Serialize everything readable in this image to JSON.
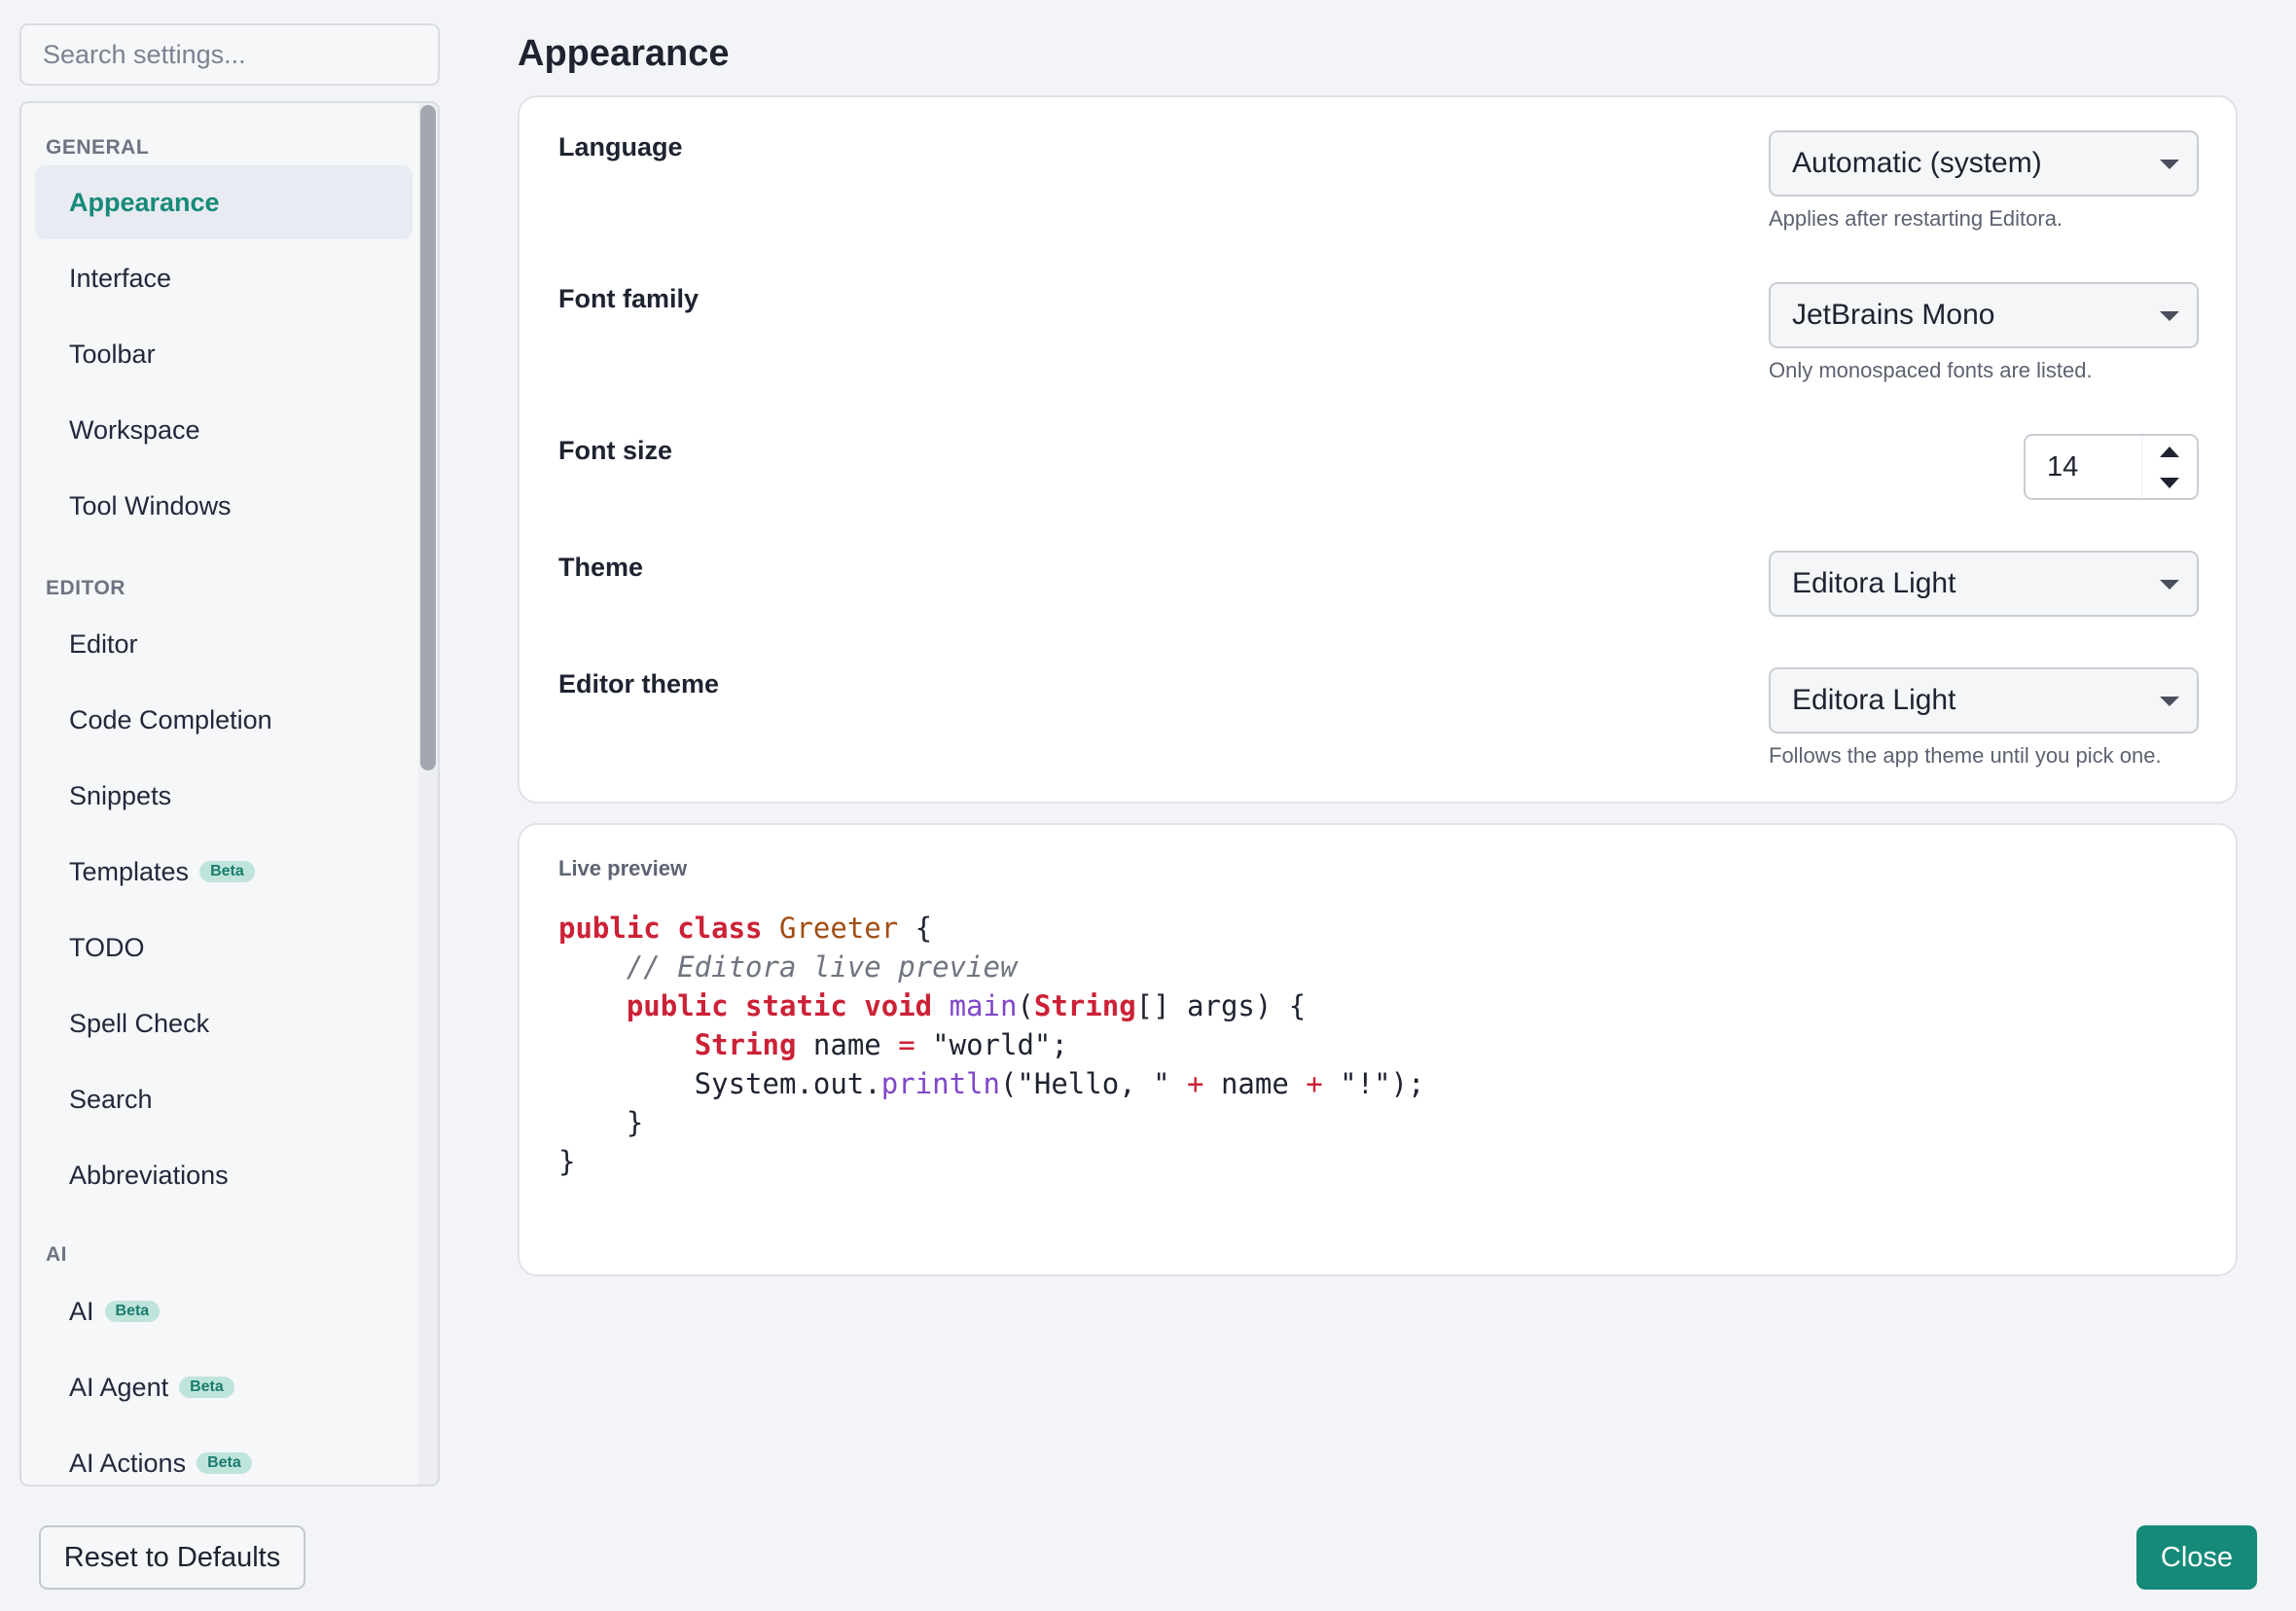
{
  "search": {
    "placeholder": "Search settings..."
  },
  "sidebar": {
    "sections": [
      {
        "title": "GENERAL",
        "items": [
          {
            "label": "Appearance",
            "active": true
          },
          {
            "label": "Interface"
          },
          {
            "label": "Toolbar"
          },
          {
            "label": "Workspace"
          },
          {
            "label": "Tool Windows"
          }
        ]
      },
      {
        "title": "EDITOR",
        "items": [
          {
            "label": "Editor"
          },
          {
            "label": "Code Completion"
          },
          {
            "label": "Snippets"
          },
          {
            "label": "Templates",
            "badge": "Beta"
          },
          {
            "label": "TODO"
          },
          {
            "label": "Spell Check"
          },
          {
            "label": "Search"
          },
          {
            "label": "Abbreviations"
          }
        ]
      },
      {
        "title": "AI",
        "items": [
          {
            "label": "AI",
            "badge": "Beta"
          },
          {
            "label": "AI Agent",
            "badge": "Beta"
          },
          {
            "label": "AI Actions",
            "badge": "Beta"
          }
        ]
      }
    ]
  },
  "main": {
    "title": "Appearance",
    "settings": {
      "language": {
        "label": "Language",
        "value": "Automatic (system)",
        "hint": "Applies after restarting Editora."
      },
      "font_family": {
        "label": "Font family",
        "value": "JetBrains Mono",
        "hint": "Only monospaced fonts are listed."
      },
      "font_size": {
        "label": "Font size",
        "value": "14"
      },
      "theme": {
        "label": "Theme",
        "value": "Editora Light"
      },
      "editor_theme": {
        "label": "Editor theme",
        "value": "Editora Light",
        "hint": "Follows the app theme until you pick one."
      }
    },
    "preview": {
      "label": "Live preview",
      "code_lines": [
        [
          {
            "t": "public class ",
            "k": "kw"
          },
          {
            "t": "Greeter",
            "k": "cls"
          },
          {
            "t": " {",
            "k": ""
          }
        ],
        [
          {
            "t": "    ",
            "k": ""
          },
          {
            "t": "// Editora live preview",
            "k": "cm"
          }
        ],
        [
          {
            "t": "    ",
            "k": ""
          },
          {
            "t": "public static void ",
            "k": "kw"
          },
          {
            "t": "main",
            "k": "fn"
          },
          {
            "t": "(",
            "k": ""
          },
          {
            "t": "String",
            "k": "kw"
          },
          {
            "t": "[] args) {",
            "k": ""
          }
        ],
        [
          {
            "t": "        ",
            "k": ""
          },
          {
            "t": "String",
            "k": "kw"
          },
          {
            "t": " name ",
            "k": ""
          },
          {
            "t": "=",
            "k": "op"
          },
          {
            "t": " \"world\";",
            "k": ""
          }
        ],
        [
          {
            "t": "        System.out.",
            "k": ""
          },
          {
            "t": "println",
            "k": "fn"
          },
          {
            "t": "(\"Hello, \" ",
            "k": ""
          },
          {
            "t": "+",
            "k": "op"
          },
          {
            "t": " name ",
            "k": ""
          },
          {
            "t": "+",
            "k": "op"
          },
          {
            "t": " \"!\");",
            "k": ""
          }
        ],
        [
          {
            "t": "    }",
            "k": ""
          }
        ],
        [
          {
            "t": "}",
            "k": ""
          }
        ]
      ]
    }
  },
  "footer": {
    "reset_label": "Reset to Defaults",
    "close_label": "Close"
  },
  "colors": {
    "accent": "#168a79",
    "badge_bg": "#bfe4dc",
    "keyword": "#cc2136",
    "class_name": "#a04d13",
    "function": "#7f47c9",
    "comment": "#6f7480"
  }
}
